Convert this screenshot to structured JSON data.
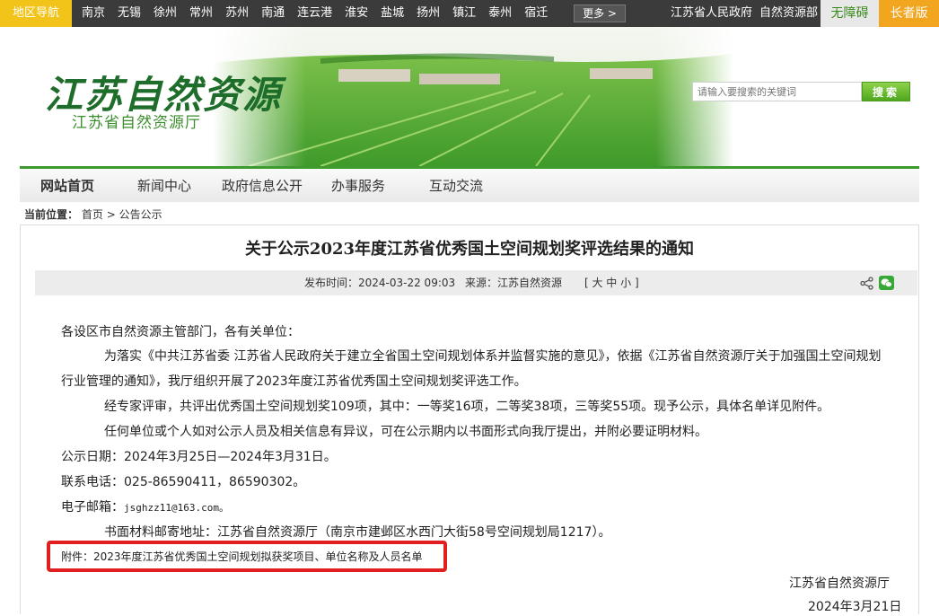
{
  "topbar": {
    "region_label": "地区导航",
    "cities": [
      "南京",
      "无锡",
      "徐州",
      "常州",
      "苏州",
      "南通",
      "连云港",
      "淮安",
      "盐城",
      "扬州",
      "镇江",
      "泰州",
      "宿迁"
    ],
    "more_label": "更多 >",
    "gov_link": "江苏省人民政府",
    "ministry_link": "自然资源部",
    "accessibility_label": "无障碍",
    "elder_label": "长者版"
  },
  "banner": {
    "logo_title": "江苏自然资源",
    "logo_sub": "江苏省自然资源厅",
    "search_placeholder": "请输入要搜索的关键词",
    "search_button": "搜索"
  },
  "nav": {
    "items": [
      "网站首页",
      "新闻中心",
      "政府信息公开",
      "办事服务",
      "互动交流"
    ]
  },
  "breadcrumb": {
    "label": "当前位置：",
    "home": "首页",
    "sep": ">",
    "current": "公告公示"
  },
  "article": {
    "title": "关于公示2023年度江苏省优秀国土空间规划奖评选结果的通知",
    "publish_time": "发布时间：2024-03-22 09:03",
    "source": "来源：江苏自然资源",
    "font_size": "[ 大 中 小 ]",
    "salutation": "各设区市自然资源主管部门，各有关单位：",
    "para1_line1": "为落实《中共江苏省委 江苏省人民政府关于建立全省国土空间规划体系并监督实施的意见》，依据《江苏省自然资源厅关于加强国土空间规划",
    "para1_line2": "行业管理的通知》，我厅组织开展了2023年度江苏省优秀国土空间规划奖评选工作。",
    "para2": "经专家评审，共评出优秀国土空间规划奖109项，其中：一等奖16项，二等奖38项，三等奖55项。现予公示，具体名单详见附件。",
    "para3": "任何单位或个人如对公示人员及相关信息有异议，可在公示期内以书面形式向我厅提出，并附必要证明材料。",
    "period": "公示日期：2024年3月25日—2024年3月31日。",
    "phone": "联系电话：025-86590411，86590302。",
    "email_label": "电子邮箱：",
    "email": "jsghzz11@163.com。",
    "address": "书面材料邮寄地址：江苏省自然资源厅（南京市建邺区水西门大街58号空间规划局1217）。",
    "attachment": "附件：2023年度江苏省优秀国土空间规划拟获奖项目、单位名称及人员名单",
    "signature": "江苏省自然资源厅",
    "date": "2024年3月21日"
  },
  "colors": {
    "top_bar": "#3b3b3b",
    "region_yellow": "#f2c319",
    "elder_orange": "#f2a51f",
    "nav_green": "#3d9a2d",
    "highlight_red": "#e02020"
  }
}
